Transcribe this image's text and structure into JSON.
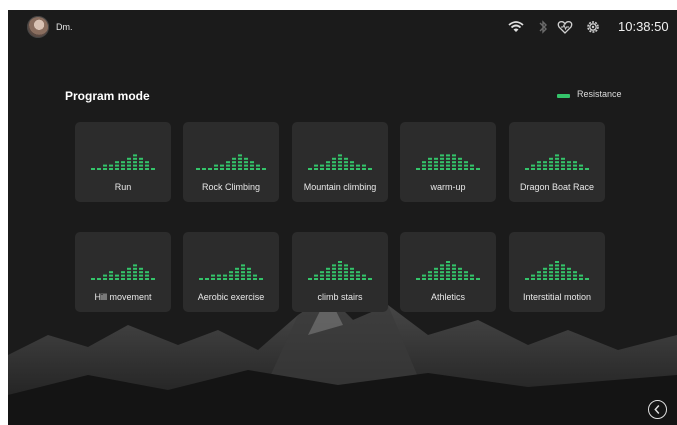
{
  "status_bar": {
    "username": "Dm.",
    "time": "10:38:50",
    "icons": [
      "wifi-icon",
      "bluetooth-icon",
      "heart-icon",
      "gear-icon"
    ]
  },
  "header": {
    "title": "Program mode"
  },
  "legend": {
    "label": "Resistance",
    "color": "#34c46a"
  },
  "programs": [
    {
      "label": "Run",
      "profile": [
        1,
        1,
        2,
        2,
        3,
        3,
        4,
        5,
        4,
        3,
        1
      ]
    },
    {
      "label": "Rock Climbing",
      "profile": [
        1,
        1,
        1,
        2,
        2,
        3,
        4,
        5,
        4,
        3,
        2,
        1
      ]
    },
    {
      "label": "Mountain climbing",
      "profile": [
        1,
        2,
        2,
        3,
        4,
        5,
        4,
        3,
        2,
        2,
        1
      ]
    },
    {
      "label": "warm-up",
      "profile": [
        1,
        3,
        4,
        4,
        5,
        5,
        5,
        4,
        3,
        2,
        1
      ]
    },
    {
      "label": "Dragon Boat Race",
      "profile": [
        1,
        2,
        3,
        3,
        4,
        5,
        4,
        3,
        3,
        2,
        1
      ]
    },
    {
      "label": "Hill movement",
      "profile": [
        1,
        1,
        2,
        3,
        2,
        3,
        4,
        5,
        4,
        3,
        1
      ]
    },
    {
      "label": "Aerobic exercise",
      "profile": [
        1,
        1,
        2,
        2,
        2,
        3,
        4,
        5,
        4,
        2,
        1
      ]
    },
    {
      "label": "climb stairs",
      "profile": [
        1,
        2,
        3,
        4,
        5,
        6,
        5,
        4,
        3,
        2,
        1
      ]
    },
    {
      "label": "Athletics",
      "profile": [
        1,
        2,
        3,
        4,
        5,
        6,
        5,
        4,
        3,
        2,
        1
      ]
    },
    {
      "label": "Interstitial motion",
      "profile": [
        1,
        2,
        3,
        4,
        5,
        6,
        5,
        4,
        3,
        2,
        1
      ]
    }
  ],
  "navigation": {
    "back_icon": "chevron-left-icon"
  }
}
